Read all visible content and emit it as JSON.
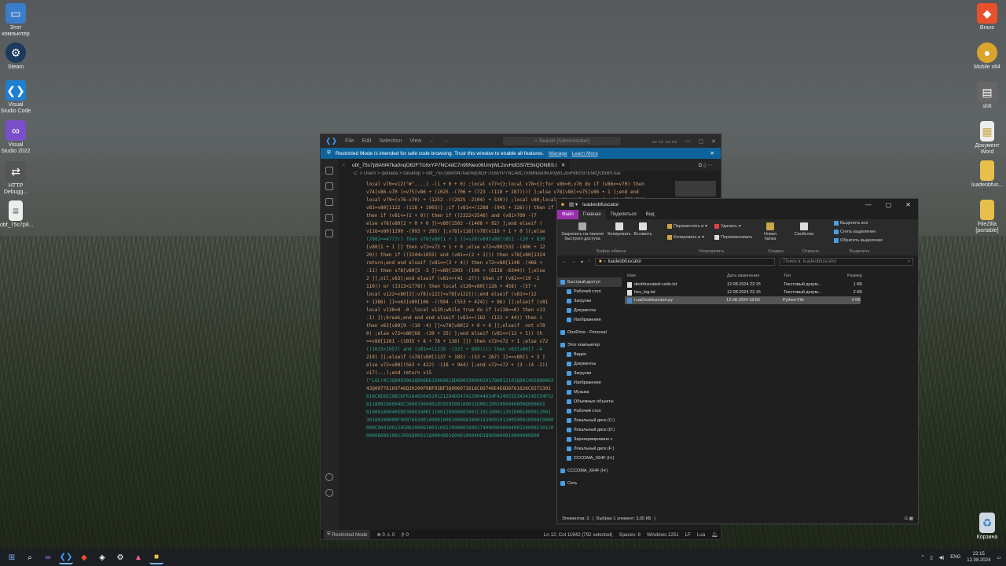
{
  "desktop": {
    "left_icons": [
      {
        "label": "Этот компьютер",
        "icon": "computer-icon"
      },
      {
        "label": "Steam",
        "icon": "steam-icon"
      },
      {
        "label": "Visual Studio Code",
        "icon": "vscode-icon"
      },
      {
        "label": "Visual Studio 2022",
        "icon": "visual-studio-icon"
      },
      {
        "label": "HTTP Debugg...",
        "icon": "http-debugger-icon"
      },
      {
        "label": "obf_75s7p8...",
        "icon": "file-icon"
      }
    ],
    "right_icons": [
      {
        "label": "Brave",
        "icon": "brave-icon"
      },
      {
        "label": "Mobile x64",
        "icon": "mobile-icon"
      },
      {
        "label": "sh6",
        "icon": "folder-icon"
      },
      {
        "label": "Документ Word",
        "icon": "document-icon"
      },
      {
        "label": "luadeobfus...",
        "icon": "folder-icon"
      },
      {
        "label": "FileZilla [portable]",
        "icon": "filezilla-icon"
      },
      {
        "label": "Корзина",
        "icon": "recycle-bin-icon"
      }
    ]
  },
  "vscode": {
    "menu": [
      "File",
      "Edit",
      "Selection",
      "View"
    ],
    "search_placeholder": "Search [Administrator]",
    "banner_text": "Restricted Mode is intended for safe code browsing. Trust this window to enable all features.",
    "banner_manage": "Manage",
    "banner_learn": "Learn More",
    "tab_name": "obf_75s7p8Ahf47ka0nqO62F7i16xYP7NC4dC7n99Neo06UnrjWL2ovHdGSl7E5kQONBS.lua",
    "breadcrumb": "C: > Users > qwnada > Desktop > obf_75s7p8Ahf47ka0nqO62F7i16xYP7NC4dC7n99Neo06UnrjWL2ovHdGSl7E5kQONBS.lua",
    "code_lines": [
      "local v70=v12(\"#\",...) -(1 + 0 + 0) ;local v77={};local v78={};for v86=0,v76 do if (v86>=v70) then",
      "v74[v86-v70 ]=v75[v86 + (1025 -(706 + (723 -(118 + 287)))) ];else v78[v86]=v75[v86 + 1 ];end end",
      "local v79=(v76-v70) + (1252 -((2825 -2104) + 530)) ;local v80;local v81;while true do v80=v77[v71];",
      "v81=v80[1122 -(118 + 1003)] ;if (v81<=(1288 -(945 + 326))) then if (v81<=",
      "then if (v81<=(1 + 0)) then if ((2322<3546) and (v81>700 -(7",
      "else v78[v80[2 + 0 + 0 ]]=v80[1503 -(1408 + 92) ];end elseif (",
      "v116=v80[1290 -(993 + 295) ];v78[v116](v78[v116 + 1 + 0 ]);else",
      "(2082==4773)) then v78[v80[1 + 1 ]]=v29(v69[v80[(851 -(20 + 830",
      "[v80[1 + 1 ]] then v72=v72 + 1 + 0 ;else v72=v80[532 -(406 + 12",
      "20)) then if ((3244>1055) and (v81==(2 + 1))) then v78[v80[1324",
      "return;end end elseif (v81<=(3 + 4)) then v72=v80[1148 -(466 +",
      "-11) then v78[v80[5 -3 ]]=v80[1903 -(106 + (8138 -6344)) ];else",
      "2 ]],nil,v63);end elseif (v81<=(41 -27)) then if (v81<=(29 -2",
      "110)) or (3313<1778)) then local v120=v80[(128 + 458) -(57 +",
      "local v122=v80[2];v78[v122]=v78[v122]();end elseif (v81<=(12",
      "+ 1386) ]]=v63[v80[106 -((994 -(553 + 424)) + 86) ]];elseif (v81",
      "local v138=0 -0 ;local v139;while true do if (v138==0) then v13",
      "-1) ]);break;end end end elseif (v81<=(182 -(122 + 44)) then i",
      "then v63[v80[9 -(10 -4) ]]=v78[v80[2 + 0 + 0 ]];elseif  not v78",
      "0) ;else v72=v80[68 -(30 + 35) ];end elseif (v81<=(12 + 5)) th",
      "==v80[1261 -(1035 + 8 + 78 + 136) ]]) then v72=v72 + 1 ;else v72",
      "((1623<1957) and (v81==(1238 -(323 + 889)))) then v63[v80[7 -4",
      "219) ]];elseif (v78[v80[(137 + 185) -(53 + 267) ]]==v80[1 + 3 ]",
      "else v72=v80[(563 + 422) -(18 + 964) ];end v72=v72 + (3 -(4 -2))",
      "v17(...);end return v15",
      "(\"LOL!0C3Q00030A3Q006D616960616D6003300002017Q0012103Q001403Q00063",
      "43Q00776169746Q30200F0BF03BF3Q006973616C6D746E4E6D6F61626C6572302",
      "616C6E6E206C6F61646564520121284D5474120044654F42465553434145554F52",
      "011800280004DC3000790000105028500100033Q0012002000040000Q000601",
      "010001000405D030001000C1100120000003001C1011000113010001000012001",
      "30100200000F00076020014000100010000A3000143000101200500020000C0000",
      "000C00010012050020006300310012090003000274000004000400120000210120",
      "0000600010012093Q00023Q00040D3Q000100040D3Q000A00010004000D00"
    ],
    "status": {
      "restricted": "Restricted Mode",
      "problems": "⊗ 0 ⚠ 0",
      "ports": "⚲ 0",
      "position": "Ln 12, Col 11942 (792 selected)",
      "spaces": "Spaces: 8",
      "encoding": "Windows 1251",
      "eol": "LF",
      "language": "Lua"
    }
  },
  "explorer": {
    "title": "luadeobfuscator",
    "tabs": [
      "Файл",
      "Главная",
      "Поделиться",
      "Вид"
    ],
    "ribbon": {
      "pin": "Закрепить на панели быстрого доступа",
      "copy": "Копировать",
      "paste": "Вставить",
      "move_to": "Переместить в",
      "copy_to": "Копировать в",
      "delete": "Удалить",
      "rename": "Переименовать",
      "new_folder": "Новая папка",
      "properties": "Свойства",
      "select_all": "Выделить все",
      "select_none": "Снять выделение",
      "invert": "Обратить выделение",
      "groups": [
        "Буфер обмена",
        "Упорядочить",
        "Создать",
        "Открыть",
        "Выделить"
      ]
    },
    "address": "luadeobfuscator",
    "search_placeholder": "Поиск в: luadeobfuscator",
    "nav": [
      {
        "label": "Быстрый доступ",
        "selected": true
      },
      {
        "label": "Рабочий стол"
      },
      {
        "label": "Загрузки"
      },
      {
        "label": "Документы"
      },
      {
        "label": "Изображения"
      },
      {
        "label": "OneDrive - Personal"
      },
      {
        "label": "Этот компьютер"
      },
      {
        "label": "Видео"
      },
      {
        "label": "Документы"
      },
      {
        "label": "Загрузки"
      },
      {
        "label": "Изображения"
      },
      {
        "label": "Музыка"
      },
      {
        "label": "Объемные объекты"
      },
      {
        "label": "Рабочий стол"
      },
      {
        "label": "Локальный диск (C:)"
      },
      {
        "label": "Локальный диск (D:)"
      },
      {
        "label": "Зарезервировано с"
      },
      {
        "label": "Локальный диск (F:)"
      },
      {
        "label": "CCCOMA_X64F (H:)"
      },
      {
        "label": "CCCOMA_X64F (H:)"
      },
      {
        "label": "Сеть"
      }
    ],
    "columns": [
      "Имя",
      "Дата изменения",
      "Тип",
      "Размер"
    ],
    "files": [
      {
        "name": "deobfuscated-code.txt",
        "date": "12.08.2024 22:15",
        "type": "Текстовый докум...",
        "size": "1 КБ",
        "selected": false
      },
      {
        "name": "hex_log.txt",
        "date": "12.08.2024 22:15",
        "type": "Текстовый докум...",
        "size": "2 КБ",
        "selected": false
      },
      {
        "name": "LuaDeobfuscator.py",
        "date": "12.08.2024 18:56",
        "type": "Python File",
        "size": "4 КБ",
        "selected": true
      }
    ],
    "status": {
      "count": "Элементов: 3",
      "selected": "Выбран 1 элемент: 3,05 КБ"
    }
  },
  "taskbar": {
    "lang": "ENG",
    "time": "22:15",
    "date": "12.08.2024"
  }
}
